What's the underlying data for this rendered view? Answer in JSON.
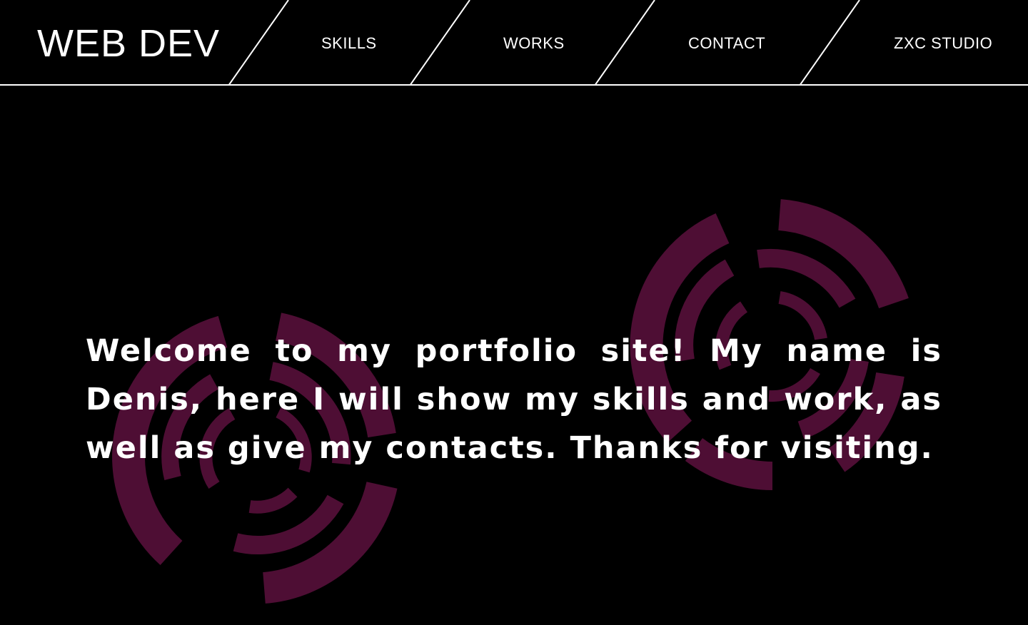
{
  "header": {
    "logo": "WEB DEV",
    "nav": [
      {
        "label": "SKILLS"
      },
      {
        "label": "WORKS"
      },
      {
        "label": "CONTACT"
      },
      {
        "label": "ZXC STUDIO"
      }
    ]
  },
  "hero": {
    "text": "Welcome to my portfolio site! My name is Denis, here I will show my skills and work, as well as give my contacts. Thanks for visiting."
  },
  "colors": {
    "background": "#000000",
    "foreground": "#ffffff",
    "accent": "#4e0e34"
  },
  "decorations": [
    {
      "icon": "concentric-arc-target-icon"
    },
    {
      "icon": "concentric-arc-target-icon"
    }
  ]
}
